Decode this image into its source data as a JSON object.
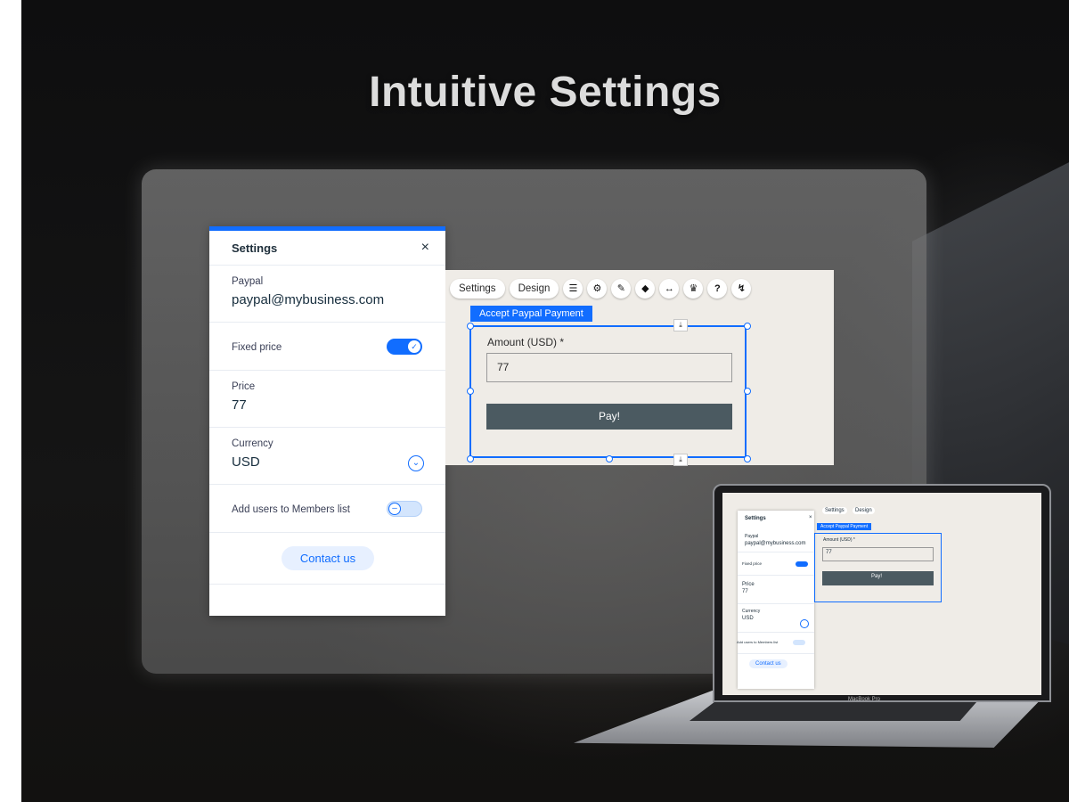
{
  "hero": {
    "title": "Intuitive Settings"
  },
  "settings_panel": {
    "title": "Settings",
    "close_glyph": "×",
    "paypal": {
      "label": "Paypal",
      "value": "paypal@mybusiness.com"
    },
    "fixed_price": {
      "label": "Fixed price",
      "on": true
    },
    "price": {
      "label": "Price",
      "value": "77"
    },
    "currency": {
      "label": "Currency",
      "value": "USD"
    },
    "members": {
      "label": "Add users to Members list",
      "on": false
    },
    "contact_button": "Contact us"
  },
  "editor": {
    "toolbar": {
      "settings": "Settings",
      "design": "Design",
      "icons": [
        "checklist-icon",
        "gear-icon",
        "brush-icon",
        "animation-icon",
        "stretch-icon",
        "crown-icon",
        "help-icon",
        "connect-icon"
      ]
    },
    "tag": "Accept Paypal Payment",
    "amount_label": "Amount (USD) *",
    "amount_value": "77",
    "pay_button": "Pay!"
  },
  "laptop": {
    "brand": "MacBook Pro",
    "panel_title": "Settings",
    "paypal_label": "Paypal",
    "paypal_value": "paypal@mybusiness.com",
    "fixed_price": "Fixed price",
    "price_label": "Price",
    "price_value": "77",
    "currency_label": "Currency",
    "currency_value": "USD",
    "members": "Add users to Members list",
    "contact": "Contact us",
    "settings": "Settings",
    "design": "Design",
    "tag": "Accept Paypal Payment",
    "amount_label": "Amount (USD) *",
    "amount_value": "77",
    "pay": "Pay!"
  },
  "colors": {
    "accent": "#116dff",
    "pay_button": "#4b5a61",
    "canvas": "#efece7"
  }
}
